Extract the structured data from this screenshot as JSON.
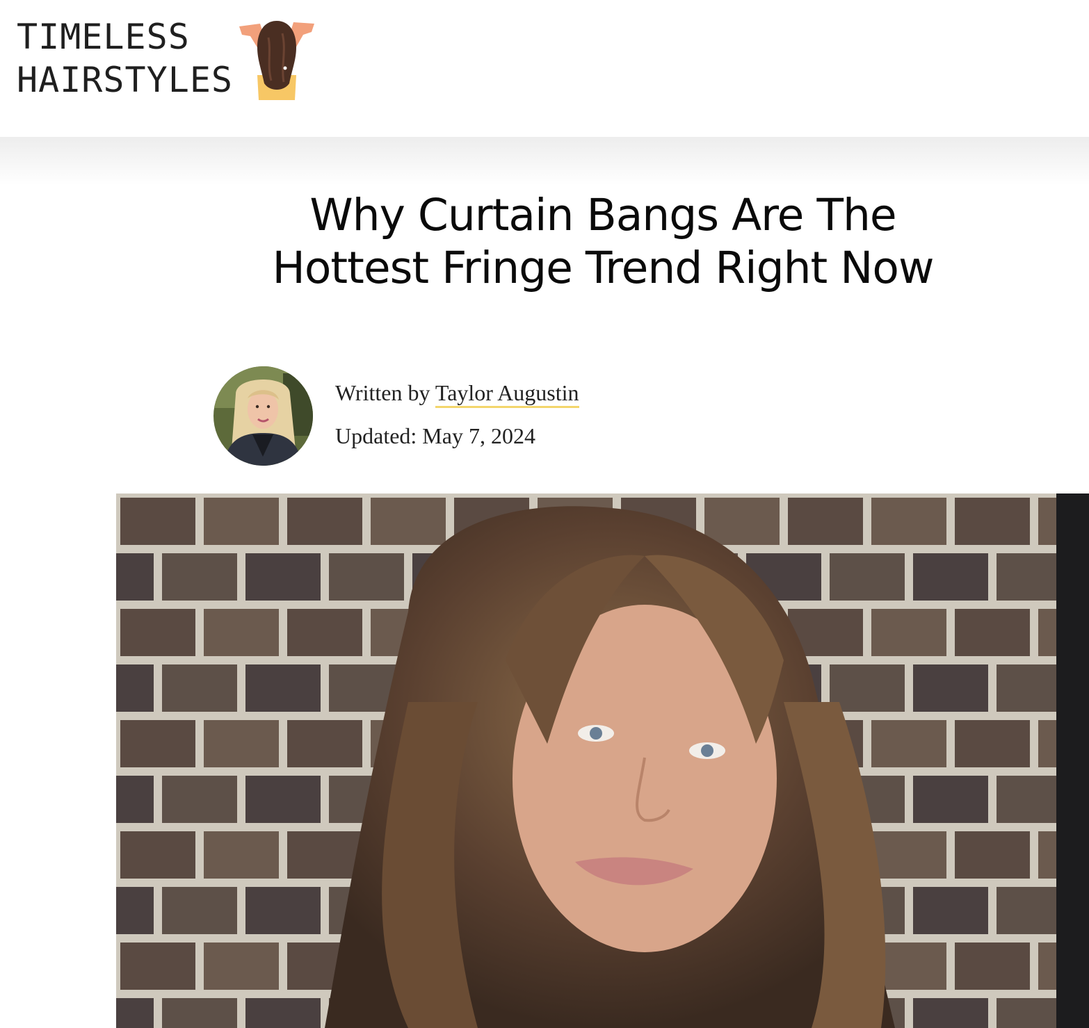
{
  "header": {
    "logo_line1": "TIMELESS",
    "logo_line2": "HAIRSTYLES"
  },
  "article": {
    "title_line1": "Why Curtain Bangs Are The",
    "title_line2": "Hottest Fringe Trend Right Now",
    "byline_prefix": "Written by",
    "author": "Taylor Augustin",
    "updated_label": "Updated:",
    "updated_date": "May 7, 2024"
  },
  "icons": {
    "logo": "woman-back-hair-icon"
  },
  "colors": {
    "author_underline": "#f3d66c",
    "title": "#0a0a0a",
    "logo_text": "#1f1f1f",
    "logo_hair": "#4a2e22",
    "logo_skin": "#f2a07b",
    "logo_shirt": "#f7c765"
  }
}
